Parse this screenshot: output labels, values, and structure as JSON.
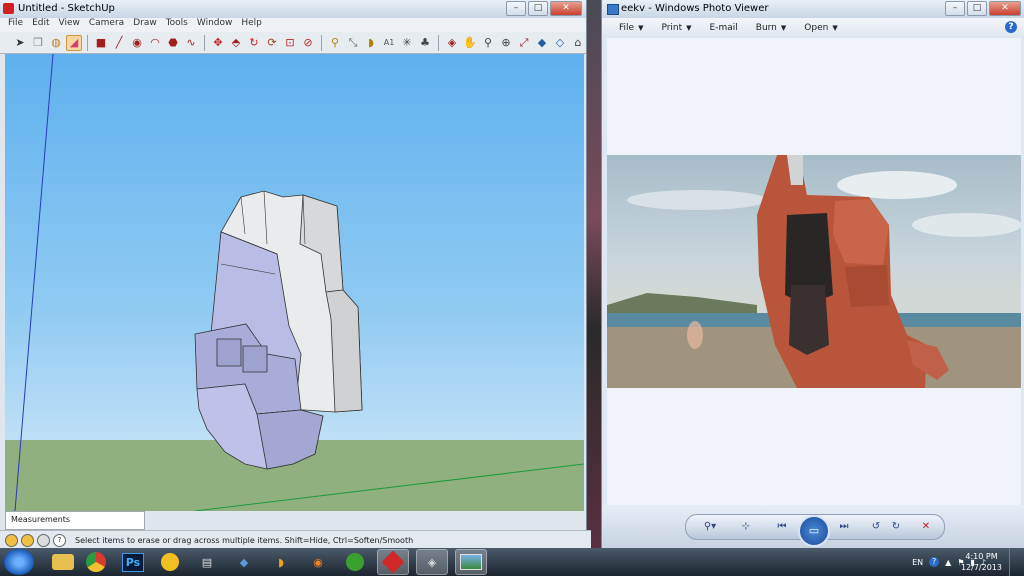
{
  "sketchup": {
    "title": "Untitled - SketchUp",
    "menu": [
      "File",
      "Edit",
      "View",
      "Camera",
      "Draw",
      "Tools",
      "Window",
      "Help"
    ],
    "tools": [
      "select",
      "component",
      "paint",
      "eraser",
      "rectangle",
      "line",
      "circle",
      "arc",
      "polygon",
      "freehand",
      "move",
      "push-pull",
      "rotate",
      "follow-me",
      "scale",
      "offset",
      "tape",
      "dimension",
      "protractor",
      "text",
      "axes",
      "3d-text",
      "orbit",
      "pan",
      "zoom",
      "zoom-window",
      "zoom-extents",
      "previous",
      "next"
    ],
    "measurements_label": "Measurements",
    "status_text": "Select items to erase or drag across multiple items. Shift=Hide, Ctrl=Soften/Smooth"
  },
  "photoviewer": {
    "title": "eekv - Windows Photo Viewer",
    "menu": {
      "file": "File",
      "print": "Print",
      "email": "E-mail",
      "burn": "Burn",
      "open": "Open"
    },
    "help": "?",
    "controls": [
      "zoom",
      "actual-size",
      "previous",
      "slideshow",
      "next",
      "rotate-left",
      "rotate-right",
      "delete"
    ]
  },
  "taskbar": {
    "apps": [
      "explorer",
      "chrome",
      "photoshop",
      "norton",
      "utility",
      "game",
      "skype",
      "blender",
      "utorrent",
      "sketchup",
      "unity",
      "photo-viewer"
    ],
    "photoshop_label": "Ps",
    "language": "EN",
    "time": "4:10 PM",
    "date": "12/7/2013"
  },
  "colors": {
    "sky": "#8fcaf2",
    "ground": "#90b07f",
    "model_front": "#bbbde5",
    "model_side": "#e8eaea",
    "titlebar": "#c9d6e6"
  }
}
